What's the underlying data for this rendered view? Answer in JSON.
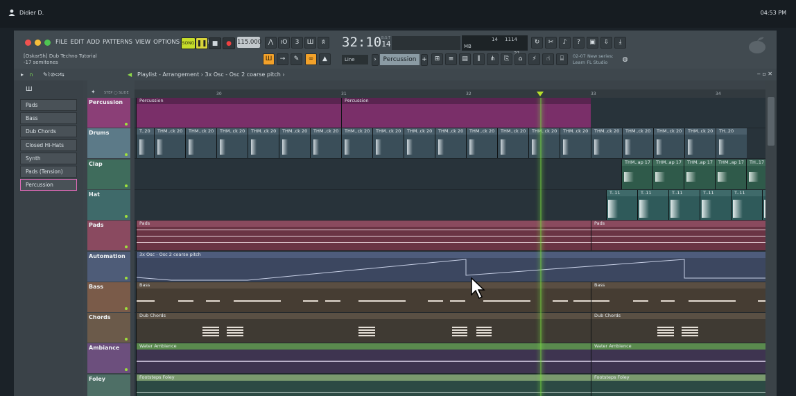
{
  "os": {
    "user": "Didier D.",
    "clock": "04:53 PM"
  },
  "menu": [
    "FILE",
    "EDIT",
    "ADD",
    "PATTERNS",
    "VIEW",
    "OPTIONS",
    "TOOLS",
    "HELP"
  ],
  "hint": {
    "line1": "[OskarSh] Dub Techno Tutorial",
    "line2": "-17 semitones"
  },
  "transport": {
    "song_label": "SONG",
    "bpm": "115.000",
    "time_main": "32:10",
    "time_sub": "14",
    "time_unit": "B:S:T"
  },
  "monitor": {
    "left": "14",
    "right": "1114 MB",
    "sub": "31"
  },
  "tool": {
    "snap": "Line",
    "pattern": "Percussion"
  },
  "news": {
    "date": "02-07",
    "title": "New series:",
    "body": "Learn FL Studio"
  },
  "playlist": {
    "title": "Playlist - Arrangement",
    "crumb": "3x Osc - Osc 2 coarse pitch"
  },
  "ruler": [
    "30",
    "31",
    "32",
    "33",
    "34"
  ],
  "patterns": [
    "Pads",
    "Bass",
    "Dub Chords",
    "Closed Hi-Hats",
    "Synth",
    "Pads (Tension)",
    "Percussion"
  ],
  "tracks": [
    {
      "name": "Percussion",
      "color": "#8b3f77"
    },
    {
      "name": "Drums",
      "color": "#5c7a88"
    },
    {
      "name": "Clap",
      "color": "#3f6c5c"
    },
    {
      "name": "Hat",
      "color": "#3f6a6a"
    },
    {
      "name": "Pads",
      "color": "#8a4a60"
    },
    {
      "name": "Automation",
      "color": "#4e5c78"
    },
    {
      "name": "Bass",
      "color": "#7a5b49"
    },
    {
      "name": "Chords",
      "color": "#6b5a4a"
    },
    {
      "name": "Ambiance",
      "color": "#6c4f7d"
    },
    {
      "name": "Foley",
      "color": "#4e6f66"
    }
  ],
  "clips": {
    "percussion": "Percussion",
    "drums": "THM..ck 20",
    "drums_first": "T..20",
    "drums_last": "TH..20",
    "clap": "THM..ap 17",
    "clap_last": "TH..17",
    "hat": "T..11",
    "pads": "Pads",
    "automation": "3x Osc - Osc 2 coarse pitch",
    "bass": "Bass",
    "chords": "Dub Chords",
    "ambience": "Water Ambience",
    "foley": "Footsteps Foley"
  },
  "colors": {
    "accent": "#f7a21b",
    "playhead": "#7bdc3c"
  }
}
